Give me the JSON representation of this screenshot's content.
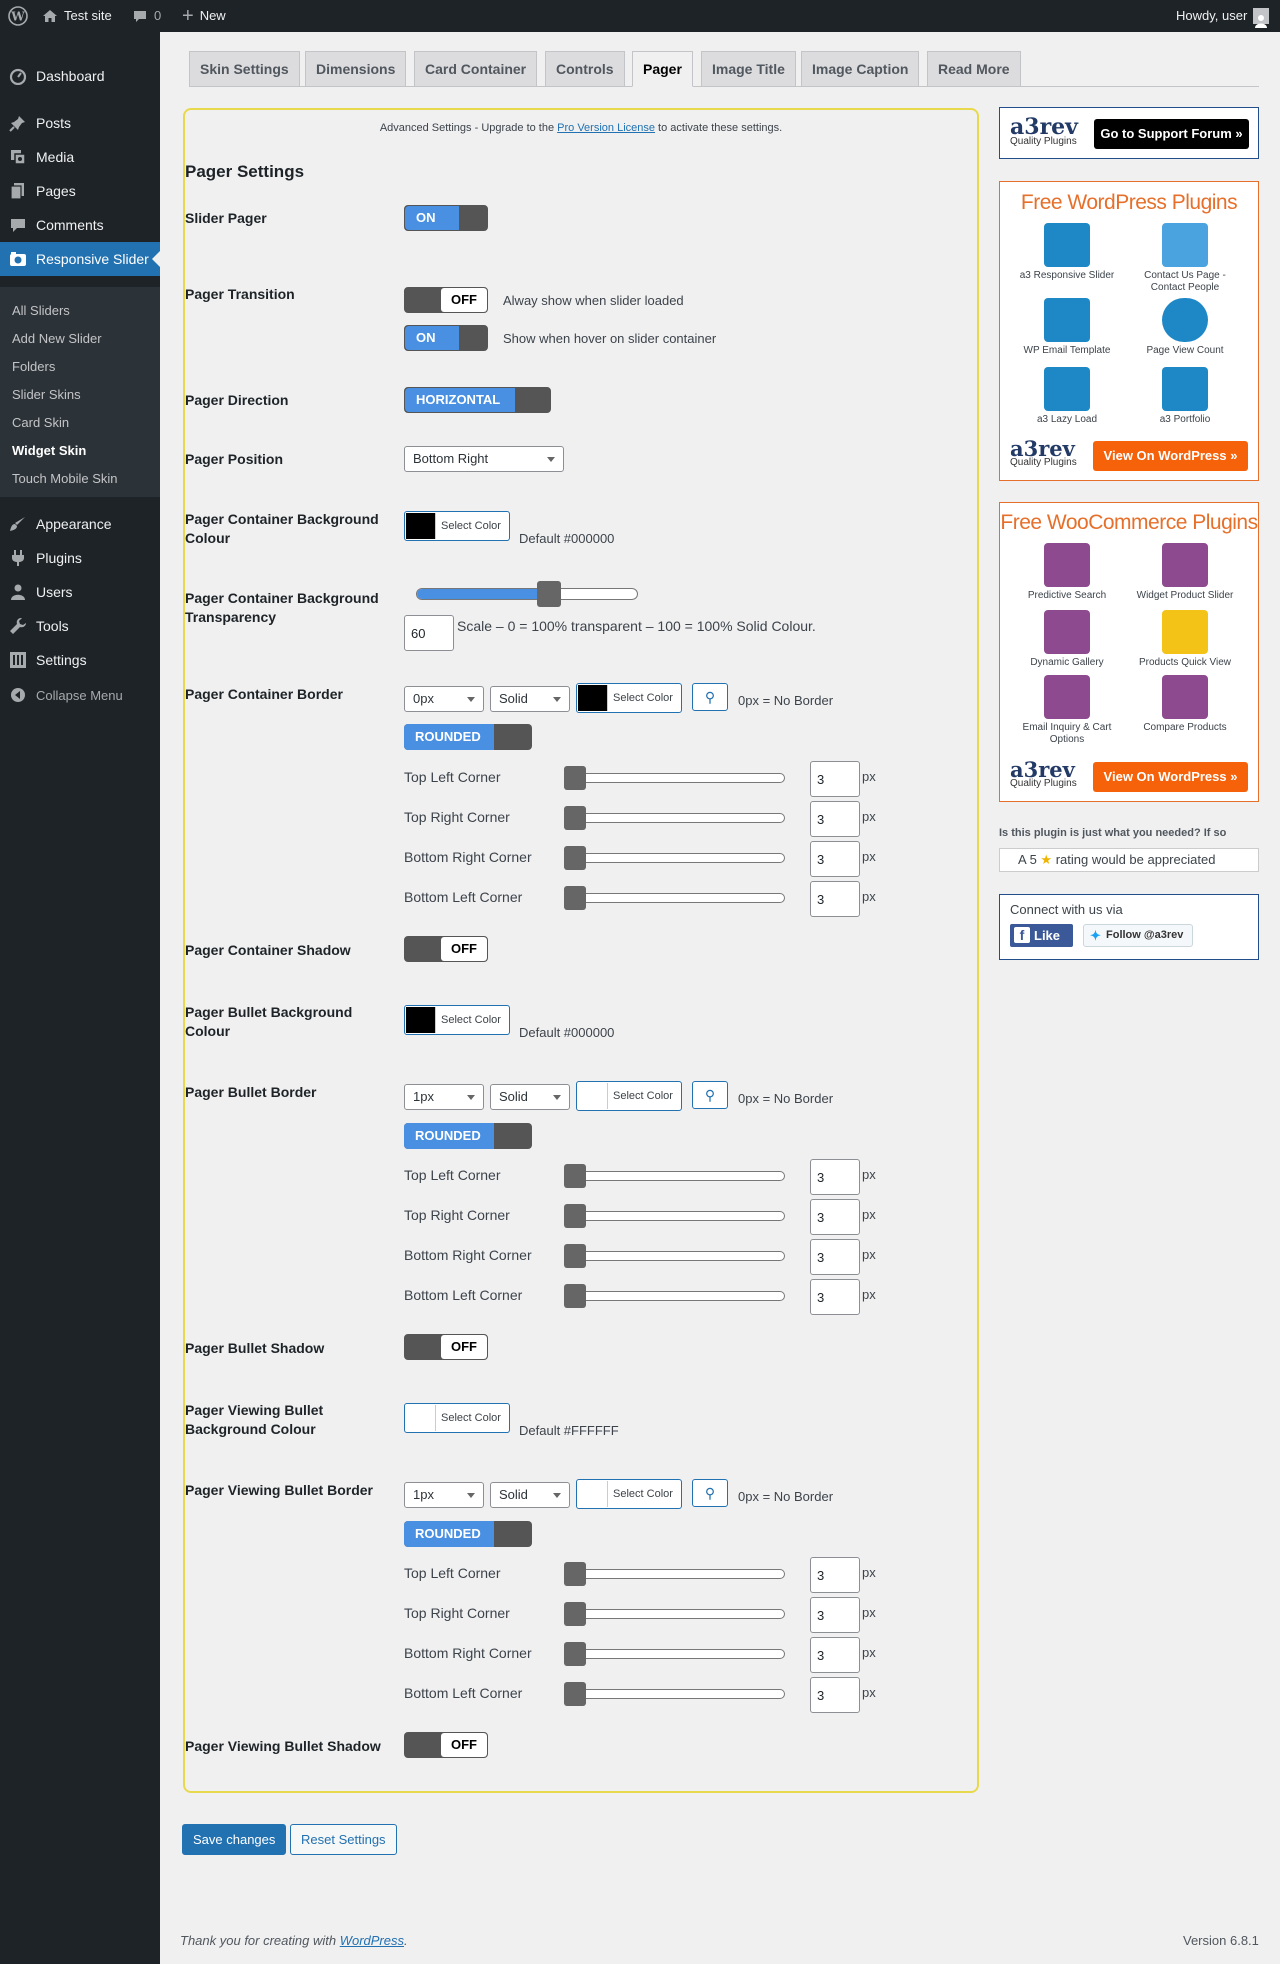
{
  "adminbar": {
    "site_name": "Test site",
    "comments_count": "0",
    "new_label": "New",
    "howdy": "Howdy, user"
  },
  "sidebar": {
    "items": [
      {
        "label": "Dashboard",
        "icon": "dashboard-icon"
      },
      {
        "label": "Posts",
        "icon": "pin-icon"
      },
      {
        "label": "Media",
        "icon": "media-icon"
      },
      {
        "label": "Pages",
        "icon": "pages-icon"
      },
      {
        "label": "Comments",
        "icon": "comment-icon"
      },
      {
        "label": "Responsive Slider",
        "icon": "camera-icon"
      },
      {
        "label": "Appearance",
        "icon": "brush-icon"
      },
      {
        "label": "Plugins",
        "icon": "plug-icon"
      },
      {
        "label": "Users",
        "icon": "users-icon"
      },
      {
        "label": "Tools",
        "icon": "wrench-icon"
      },
      {
        "label": "Settings",
        "icon": "settings-icon"
      }
    ],
    "submenu": [
      "All Sliders",
      "Add New Slider",
      "Folders",
      "Slider Skins",
      "Card Skin",
      "Widget Skin",
      "Touch Mobile Skin"
    ],
    "collapse": "Collapse Menu"
  },
  "tabs": [
    "Skin Settings",
    "Dimensions",
    "Card Container",
    "Controls",
    "Pager",
    "Image Title",
    "Image Caption",
    "Read More"
  ],
  "active_tab": "Pager",
  "advanced": {
    "prefix": "Advanced Settings - Upgrade to the ",
    "link": "Pro Version License",
    "suffix": " to activate these settings."
  },
  "section_title": "Pager Settings",
  "settings": {
    "slider_pager": {
      "label": "Slider Pager",
      "toggle": "ON"
    },
    "pager_transition": {
      "label": "Pager Transition",
      "opt1_toggle": "OFF",
      "opt1_text": "Alway show when slider loaded",
      "opt2_toggle": "ON",
      "opt2_text": "Show when hover on slider container"
    },
    "pager_direction": {
      "label": "Pager Direction",
      "toggle": "HORIZONTAL"
    },
    "pager_position": {
      "label": "Pager Position",
      "value": "Bottom Right"
    },
    "container_bg": {
      "label": "Pager Container Background Colour",
      "button": "Select Color",
      "default": "Default #000000",
      "swatch": "#000000"
    },
    "container_transparency": {
      "label": "Pager Container Background Transparency",
      "value": "60",
      "level": 0.6,
      "scale": "Scale – 0 = 100% transparent – 100 = 100% Solid Colour."
    },
    "container_border": {
      "label": "Pager Container Border",
      "width": "0px",
      "style": "Solid",
      "button": "Select Color",
      "swatch": "#000000",
      "note": "0px = No Border",
      "rounded": "ROUNDED"
    },
    "container_shadow": {
      "label": "Pager Container Shadow",
      "toggle": "OFF"
    },
    "bullet_bg": {
      "label": "Pager Bullet Background Colour",
      "button": "Select Color",
      "default": "Default #000000",
      "swatch": "#000000"
    },
    "bullet_border": {
      "label": "Pager Bullet Border",
      "width": "1px",
      "style": "Solid",
      "button": "Select Color",
      "swatch": "#ffffff",
      "note": "0px = No Border",
      "rounded": "ROUNDED"
    },
    "bullet_shadow": {
      "label": "Pager Bullet Shadow",
      "toggle": "OFF"
    },
    "viewing_bg": {
      "label": "Pager Viewing Bullet Background Colour",
      "button": "Select Color",
      "default": "Default #FFFFFF",
      "swatch": "#ffffff"
    },
    "viewing_border": {
      "label": "Pager Viewing Bullet Border",
      "width": "1px",
      "style": "Solid",
      "button": "Select Color",
      "swatch": "#ffffff",
      "note": "0px = No Border",
      "rounded": "ROUNDED"
    },
    "viewing_shadow": {
      "label": "Pager Viewing Bullet Shadow",
      "toggle": "OFF"
    }
  },
  "corners": {
    "labels": [
      "Top Left Corner",
      "Top Right Corner",
      "Bottom Right Corner",
      "Bottom Left Corner"
    ],
    "value": "3",
    "unit": "px"
  },
  "buttons": {
    "save": "Save changes",
    "reset": "Reset Settings"
  },
  "footer": {
    "thanks_prefix": "Thank you for creating with ",
    "thanks_link": "WordPress",
    "thanks_suffix": ".",
    "version": "Version 6.8.1"
  },
  "right": {
    "logo": "a3rev",
    "logo_sub": "Quality Plugins",
    "support_btn": "Go to Support Forum »",
    "wp_title": "Free WordPress Plugins",
    "wp_plugins": [
      "a3 Responsive Slider",
      "Contact Us Page - Contact People",
      "WP Email Template",
      "Page View Count",
      "a3 Lazy Load",
      "a3 Portfolio"
    ],
    "wp_btn": "View On WordPress »",
    "woo_title": "Free WooCommerce Plugins",
    "woo_plugins": [
      "Predictive Search",
      "Widget Product Slider",
      "Dynamic Gallery",
      "Products Quick View",
      "Email Inquiry & Cart Options",
      "Compare Products"
    ],
    "woo_btn": "View On WordPress »",
    "rate_question": "Is this plugin is just what you needed? If so",
    "rate_prefix": "A 5",
    "rate_suffix": "rating would be appreciated",
    "connect": "Connect with us via",
    "like": "Like",
    "follow": "Follow @a3rev"
  }
}
